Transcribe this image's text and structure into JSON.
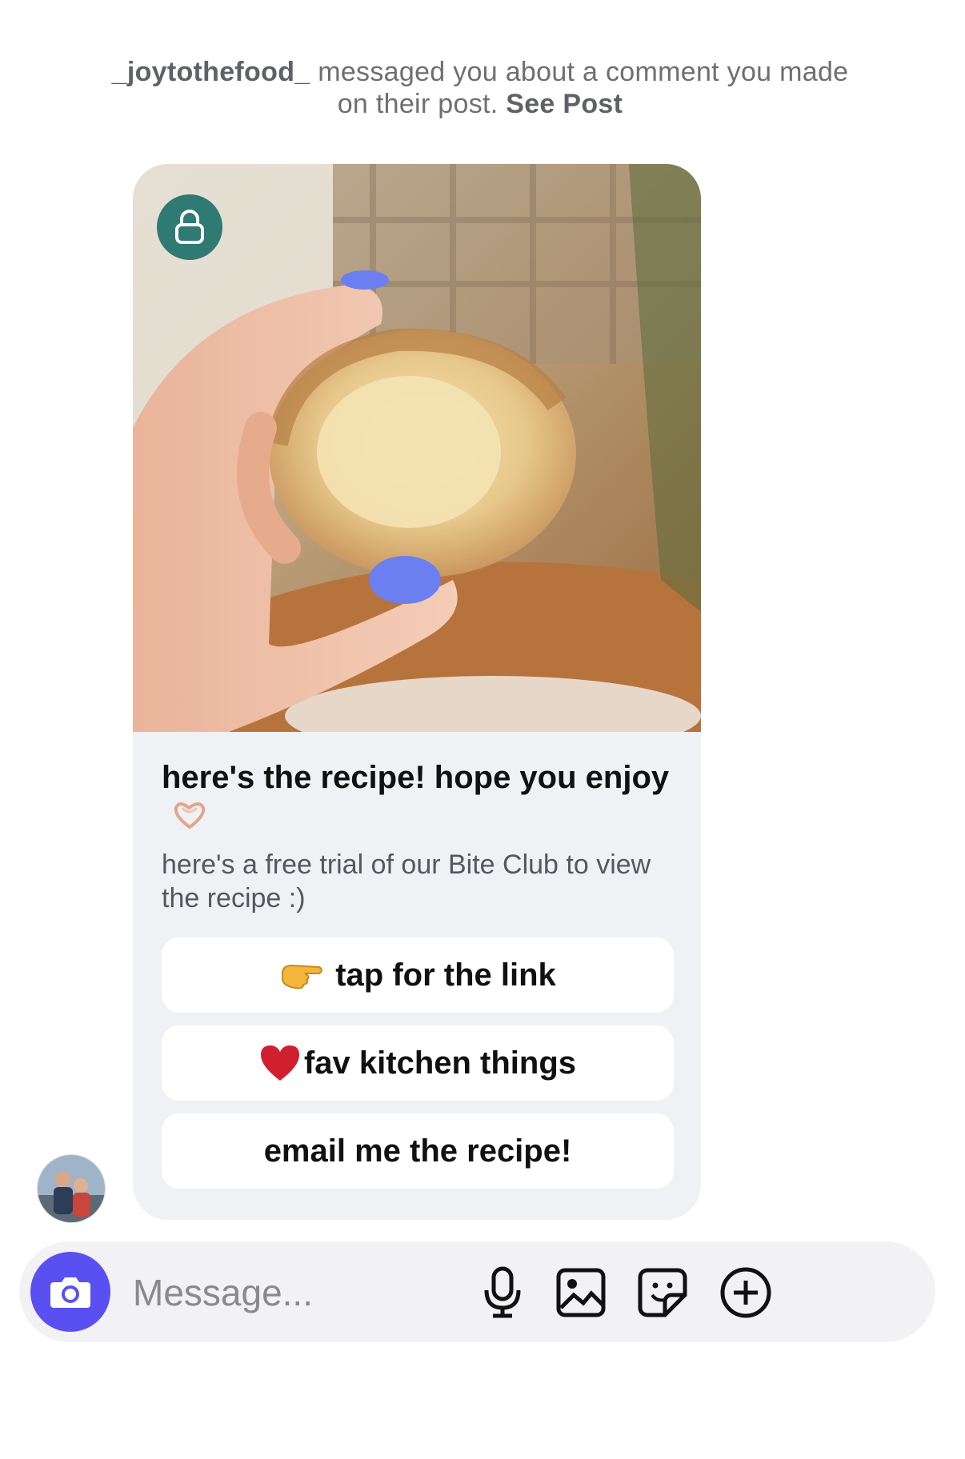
{
  "notice": {
    "username": "_joytothefood_",
    "text": " messaged you about a comment you made on their post. ",
    "link": "See Post"
  },
  "card": {
    "title": "here's the recipe! hope you enjoy",
    "title_emoji": "heart-hands",
    "subtitle": "here's a free trial of our Bite Club to view the recipe :)",
    "buttons": [
      {
        "emoji": "pointing-finger",
        "label": "tap for the link"
      },
      {
        "emoji": "red-heart",
        "label": "fav kitchen things"
      },
      {
        "emoji": "",
        "label": "email me the recipe!"
      }
    ]
  },
  "composer": {
    "placeholder": "Message...",
    "icons": [
      "camera-icon",
      "microphone-icon",
      "gallery-icon",
      "sticker-icon",
      "add-icon"
    ]
  },
  "colors": {
    "accent": "#5a4ff0",
    "lock_badge": "#2f7a72",
    "card_bg": "#f0f1f4"
  }
}
